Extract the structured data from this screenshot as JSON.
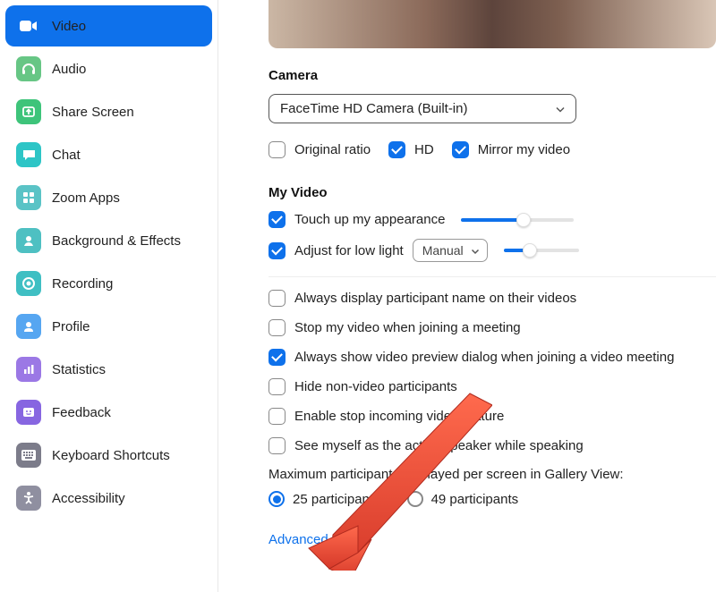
{
  "sidebar": {
    "items": [
      {
        "label": "Video",
        "icon": "video",
        "color": "#fff",
        "active": true
      },
      {
        "label": "Audio",
        "icon": "headphones",
        "color": "#67c685"
      },
      {
        "label": "Share Screen",
        "icon": "share",
        "color": "#3ec47a"
      },
      {
        "label": "Chat",
        "icon": "chat",
        "color": "#2dc5c6"
      },
      {
        "label": "Zoom Apps",
        "icon": "apps",
        "color": "#5ac3c6"
      },
      {
        "label": "Background & Effects",
        "icon": "effects",
        "color": "#4ec0c2"
      },
      {
        "label": "Recording",
        "icon": "record",
        "color": "#3fbfc3"
      },
      {
        "label": "Profile",
        "icon": "profile",
        "color": "#56a6f1"
      },
      {
        "label": "Statistics",
        "icon": "stats",
        "color": "#9b78e5"
      },
      {
        "label": "Feedback",
        "icon": "feedback",
        "color": "#8766e1"
      },
      {
        "label": "Keyboard Shortcuts",
        "icon": "keyboard",
        "color": "#7c7c8a"
      },
      {
        "label": "Accessibility",
        "icon": "accessibility",
        "color": "#8f8fa0"
      }
    ]
  },
  "camera": {
    "heading": "Camera",
    "selected": "FaceTime HD Camera (Built-in)",
    "original": {
      "label": "Original ratio",
      "checked": false
    },
    "hd": {
      "label": "HD",
      "checked": true
    },
    "mirror": {
      "label": "Mirror my video",
      "checked": true
    }
  },
  "myvideo": {
    "heading": "My Video",
    "touchup": {
      "label": "Touch up my appearance",
      "checked": true
    },
    "lowlight": {
      "label": "Adjust for low light",
      "checked": true,
      "mode": "Manual"
    }
  },
  "options": {
    "o1": {
      "label": "Always display participant name on their videos",
      "checked": false
    },
    "o2": {
      "label": "Stop my video when joining a meeting",
      "checked": false
    },
    "o3": {
      "label": "Always show video preview dialog when joining a video meeting",
      "checked": true
    },
    "o4": {
      "label": "Hide non-video participants",
      "checked": false
    },
    "o5": {
      "label": "Enable stop incoming video feature",
      "checked": false
    },
    "o6": {
      "label": "See myself as the active speaker while speaking",
      "checked": false
    }
  },
  "gallery": {
    "label": "Maximum participants displayed per screen in Gallery View:",
    "opt25": "25 participants",
    "opt49": "49 participants",
    "selected": 25
  },
  "advanced": "Advanced"
}
